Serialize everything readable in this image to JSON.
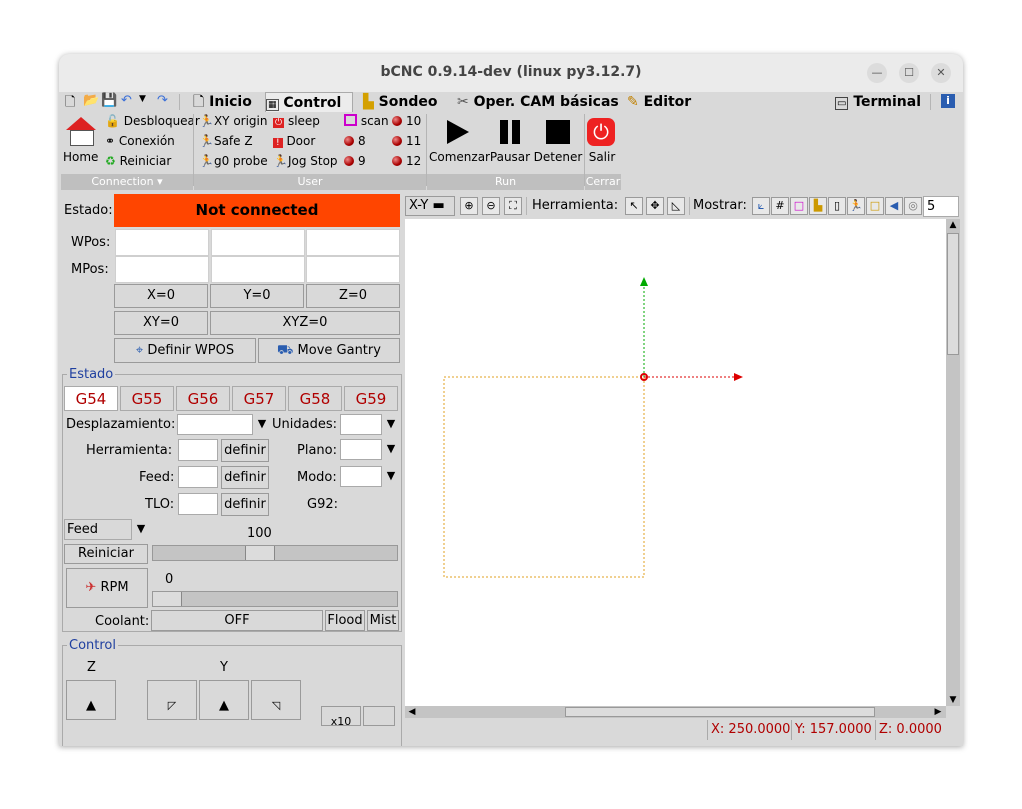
{
  "window": {
    "title": "bCNC 0.9.14-dev (linux py3.12.7)"
  },
  "menu": {
    "tabs": [
      "Inicio",
      "Control",
      "Sondeo",
      "Oper. CAM básicas",
      "Editor"
    ],
    "active_tab": "Control",
    "terminal": "Terminal"
  },
  "ribbon": {
    "connection": {
      "home": "Home",
      "unlock": "Desbloquear",
      "connect": "Conexión",
      "reset": "Reiniciar",
      "group": "Connection"
    },
    "user": {
      "xy_origin": "XY origin",
      "safe_z": "Safe Z",
      "g0_probe": "g0 probe",
      "sleep": "sleep",
      "door": "Door",
      "jog_stop": "Jog Stop",
      "scan": "scan",
      "b8": "8",
      "b9": "9",
      "b10": "10",
      "b11": "11",
      "b12": "12",
      "group": "User"
    },
    "run": {
      "start": "Comenzar",
      "pause": "Pausar",
      "stop": "Detener",
      "group": "Run"
    },
    "close": {
      "exit": "Salir",
      "group": "Cerrar"
    }
  },
  "dro": {
    "state_label": "Estado:",
    "state": "Not connected",
    "state_color": "#ff4500",
    "wpos_label": "WPos:",
    "mpos_label": "MPos:",
    "x0": "X=0",
    "y0": "Y=0",
    "z0": "Z=0",
    "xy0": "XY=0",
    "xyz0": "XYZ=0",
    "set_wpos": "Definir WPOS",
    "move_gantry": "Move Gantry"
  },
  "state_panel": {
    "title": "Estado",
    "wcs": [
      "G54",
      "G55",
      "G56",
      "G57",
      "G58",
      "G59"
    ],
    "active_wcs": "G54",
    "offset_label": "Desplazamiento:",
    "units_label": "Unidades:",
    "tool_label": "Herramienta:",
    "plane_label": "Plano:",
    "feed_label": "Feed:",
    "mode_label": "Modo:",
    "tlo_label": "TLO:",
    "g92_label": "G92:",
    "define": "definir",
    "override_select": "Feed",
    "override_value": "100",
    "override_reset": "Reiniciar",
    "rpm_button": "RPM",
    "rpm_value": "0",
    "coolant_label": "Coolant:",
    "coolant_state": "OFF",
    "flood": "Flood",
    "mist": "Mist"
  },
  "control_panel": {
    "title": "Control",
    "z_label": "Z",
    "y_label": "Y",
    "step_label": "x10"
  },
  "canvas_toolbar": {
    "view": "X-Y",
    "tool_label": "Herramienta:",
    "show_label": "Mostrar:",
    "zoom_value": "5"
  },
  "status": {
    "x": "X: 250.0000",
    "y": "Y: 157.0000",
    "z": "Z: 0.0000"
  }
}
